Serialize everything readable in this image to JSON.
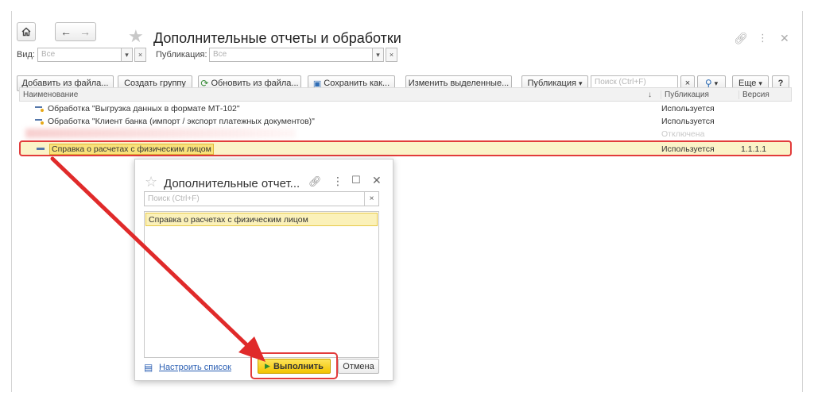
{
  "window": {
    "title": "Дополнительные отчеты и обработки"
  },
  "filters": {
    "view_label": "Вид:",
    "view_placeholder": "Все",
    "publication_label": "Публикация:",
    "publication_placeholder": "Все"
  },
  "toolbar": {
    "add_from_file": "Добавить из файла...",
    "create_group": "Создать группу",
    "update_from_file": "Обновить из файла...",
    "save_as": "Сохранить как...",
    "change_selected": "Изменить выделенные...",
    "publication": "Публикация",
    "search_placeholder": "Поиск (Ctrl+F)",
    "more": "Еще",
    "help": "?"
  },
  "table": {
    "columns": {
      "name": "Наименование",
      "publication": "Публикация",
      "version": "Версия"
    },
    "rows": [
      {
        "name": "Обработка \"Выгрузка данных в формате МТ-102\"",
        "publication": "Используется",
        "version": ""
      },
      {
        "name": "Обработка \"Клиент банка (импорт / экспорт платежных документов)\"",
        "publication": "Используется",
        "version": ""
      },
      {
        "name": "",
        "publication": "Отключена",
        "version": ""
      },
      {
        "name": "Справка о расчетах с физическим лицом",
        "publication": "Используется",
        "version": "1.1.1.1"
      }
    ]
  },
  "dialog": {
    "title": "Дополнительные отчет...",
    "search_placeholder": "Поиск (Ctrl+F)",
    "items": [
      "Справка о расчетах с физическим лицом"
    ],
    "configure_link": "Настроить список",
    "execute": "Выполнить",
    "cancel": "Отмена"
  },
  "colors": {
    "accent_yellow": "#f3c300",
    "highlight_row": "#fbf3c8",
    "annotation_red": "#e23b3b",
    "link_blue": "#2b5fb3"
  }
}
